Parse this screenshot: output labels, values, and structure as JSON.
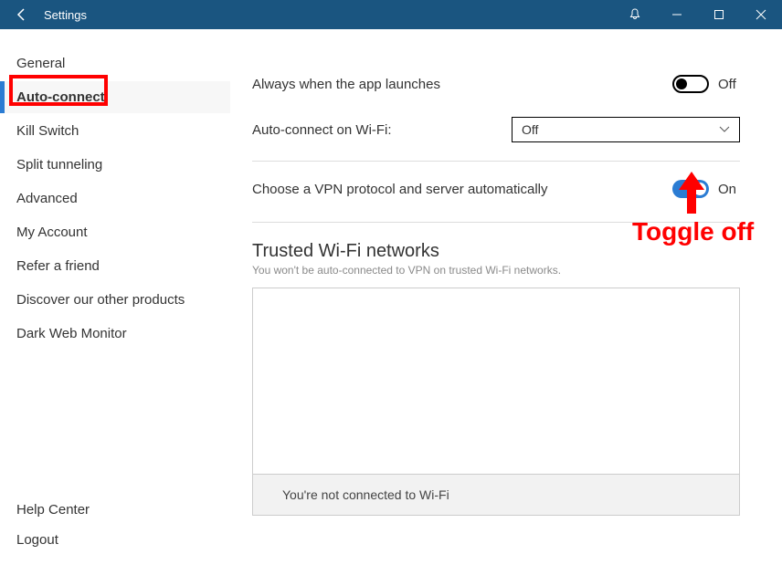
{
  "titlebar": {
    "title": "Settings"
  },
  "sidebar": {
    "items": [
      {
        "label": "General",
        "active": false
      },
      {
        "label": "Auto-connect",
        "active": true
      },
      {
        "label": "Kill Switch",
        "active": false
      },
      {
        "label": "Split tunneling",
        "active": false
      },
      {
        "label": "Advanced",
        "active": false
      },
      {
        "label": "My Account",
        "active": false
      },
      {
        "label": "Refer a friend",
        "active": false
      },
      {
        "label": "Discover our other products",
        "active": false
      },
      {
        "label": "Dark Web Monitor",
        "active": false
      }
    ],
    "bottom": [
      {
        "label": "Help Center"
      },
      {
        "label": "Logout"
      }
    ]
  },
  "main": {
    "always_launch_label": "Always when the app launches",
    "always_launch_state": "Off",
    "wifi_label": "Auto-connect on Wi-Fi:",
    "wifi_value": "Off",
    "protocol_label": "Choose a VPN protocol and server automatically",
    "protocol_state": "On",
    "trusted_title": "Trusted Wi-Fi networks",
    "trusted_sub": "You won't be auto-connected to VPN on trusted Wi-Fi networks.",
    "trusted_footer": "You're not connected to Wi-Fi"
  },
  "annotation": {
    "toggle_off": "Toggle off"
  }
}
